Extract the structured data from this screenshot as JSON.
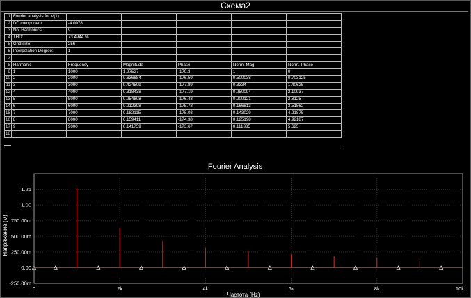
{
  "window": {
    "title": "Схема2"
  },
  "table": {
    "row_numbers": [
      "1",
      "2",
      "3",
      "4",
      "5",
      "6",
      "7",
      "8",
      "9",
      "10",
      "11",
      "12",
      "13",
      "14",
      "15",
      "16",
      "17",
      "18"
    ],
    "rows": [
      [
        "Fourier analysis for V(1):",
        "",
        "",
        "",
        "",
        ""
      ],
      [
        "DC component:",
        "-4.0078",
        "",
        "",
        "",
        ""
      ],
      [
        "No. Harmonics:",
        "9",
        "",
        "",
        "",
        ""
      ],
      [
        "THD:",
        "73.4944 %",
        "",
        "",
        "",
        ""
      ],
      [
        "Grid size:",
        "256",
        "",
        "",
        "",
        ""
      ],
      [
        "Interpolation Degree:",
        "1",
        "",
        "",
        "",
        ""
      ],
      [
        "",
        "",
        "",
        "",
        "",
        ""
      ],
      [
        "Harmonic",
        "Frequency",
        "Magnitude",
        "Phase",
        "Norm. Mag",
        "Norm. Phase"
      ],
      [
        "1",
        "1000",
        "1.27527",
        "-179.3",
        "1",
        "0"
      ],
      [
        "2",
        "2000",
        "0.636684",
        "-176.59",
        "0.500038",
        "0.703125"
      ],
      [
        "3",
        "3000",
        "0.424509",
        "-177.89",
        "0.3334",
        "1.40625"
      ],
      [
        "4",
        "4000",
        "0.318438",
        "-177.19",
        "0.250094",
        "2.10937"
      ],
      [
        "5",
        "5000",
        "0.254808",
        "-176.48",
        "0.200121",
        "2.8125"
      ],
      [
        "6",
        "6000",
        "0.212398",
        "-175.78",
        "0.166813",
        "3.51562"
      ],
      [
        "7",
        "7000",
        "0.182115",
        "-175.08",
        "0.143029",
        "4.21875"
      ],
      [
        "8",
        "8000",
        "0.159411",
        "-174.38",
        "0.125198",
        "4.92187"
      ],
      [
        "9",
        "9000",
        "0.141759",
        "-173.67",
        "0.111335",
        "5.625"
      ],
      [
        "",
        "",
        "",
        "",
        "",
        ""
      ]
    ]
  },
  "chart_data": {
    "type": "bar",
    "title": "Fourier Analysis",
    "xlabel": "Частота (Hz)",
    "ylabel": "Напряжение (V)",
    "xlim": [
      0,
      10000
    ],
    "ylim": [
      -250,
      1500
    ],
    "x_ticks": [
      0,
      2000,
      4000,
      6000,
      8000,
      10000
    ],
    "x_tick_labels": [
      "0",
      "2k",
      "4k",
      "6k",
      "8k",
      "10k"
    ],
    "y_ticks": [
      -250,
      0,
      250,
      500,
      750,
      1000,
      1250
    ],
    "y_tick_labels": [
      "-250.00m",
      "0.00",
      "250.00m",
      "500.00m",
      "750.00m",
      "1.00",
      "1.25"
    ],
    "grid": true,
    "series_color": "#c81e1e",
    "marker_color": "#ffffff",
    "x": [
      1000,
      2000,
      3000,
      4000,
      5000,
      6000,
      7000,
      8000,
      9000
    ],
    "values_mV": [
      1275.27,
      636.684,
      424.509,
      318.438,
      254.808,
      212.398,
      182.115,
      159.411,
      141.759
    ],
    "markers_x": [
      500,
      1500,
      2500,
      3500,
      4500,
      5500,
      6500,
      7500,
      8500,
      9500
    ]
  }
}
